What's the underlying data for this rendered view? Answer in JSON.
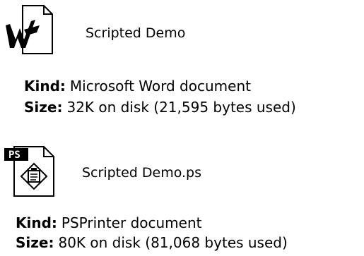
{
  "files": [
    {
      "icon": "word-document-icon",
      "name": "Scripted Demo",
      "kind_label": "Kind",
      "kind_value": "Microsoft Word document",
      "size_label": "Size",
      "size_value": "32K on disk (21,595 bytes used)"
    },
    {
      "icon": "postscript-document-icon",
      "icon_badge": "PS",
      "name": "Scripted Demo.ps",
      "kind_label": "Kind",
      "kind_value": "PSPrinter document",
      "size_label": "Size",
      "size_value": "80K on disk (81,068 bytes used)"
    }
  ]
}
